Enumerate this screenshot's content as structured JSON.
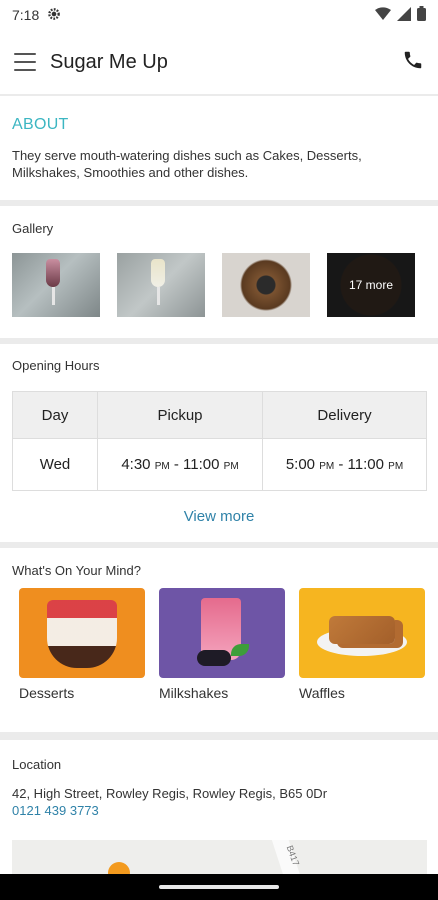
{
  "status_bar": {
    "time": "7:18"
  },
  "app_bar": {
    "title": "Sugar Me Up"
  },
  "about": {
    "title": "ABOUT",
    "text": "They serve mouth-watering dishes such as Cakes, Desserts, Milkshakes, Smoothies and other dishes."
  },
  "gallery": {
    "title": "Gallery",
    "more_label": "17 more"
  },
  "opening_hours": {
    "title": "Opening Hours",
    "headers": [
      "Day",
      "Pickup",
      "Delivery"
    ],
    "row": {
      "day": "Wed",
      "pickup_start": "4:30",
      "pickup_start_ampm": "PM",
      "pickup_sep": " - ",
      "pickup_end": "11:00",
      "pickup_end_ampm": "PM",
      "delivery_start": "5:00",
      "delivery_start_ampm": "PM",
      "delivery_sep": " - ",
      "delivery_end": "11:00",
      "delivery_end_ampm": "PM"
    },
    "view_more": "View more"
  },
  "whats_on_your_mind": {
    "title": "What's On Your Mind?",
    "categories": [
      {
        "label": "Desserts",
        "color": "#ef8e1f"
      },
      {
        "label": "Milkshakes",
        "color": "#6e55a6"
      },
      {
        "label": "Waffles",
        "color": "#f6b520"
      }
    ]
  },
  "location": {
    "title": "Location",
    "address": "42, High Street, Rowley Regis, Rowley Regis, B65 0Dr",
    "phone": "0121 439 3773",
    "map_road_label": "B417"
  },
  "colors": {
    "accent_teal": "#3cb6c2",
    "link_blue": "#2f82a8"
  }
}
